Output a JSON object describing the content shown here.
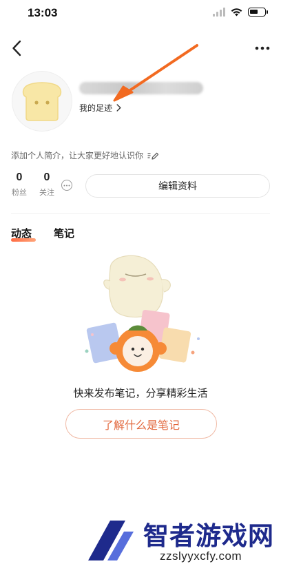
{
  "status_bar": {
    "time": "13:03",
    "battery_level": 0.6
  },
  "profile": {
    "footprint_label": "我的足迹",
    "bio_placeholder": "添加个人简介，让大家更好地认识你",
    "stats": [
      {
        "value": "0",
        "label": "粉丝"
      },
      {
        "value": "0",
        "label": "关注"
      }
    ],
    "edit_button": "编辑资料"
  },
  "tabs": [
    {
      "label": "动态",
      "active": true
    },
    {
      "label": "笔记",
      "active": false
    }
  ],
  "empty_state": {
    "message": "快来发布笔记，分享精彩生活",
    "action_button": "了解什么是笔记"
  },
  "watermark": {
    "name": "智者游戏网",
    "url": "zzslyyxcfy.com"
  },
  "colors": {
    "accent": "#ff5a2e",
    "annotation_arrow": "#f26a21",
    "watermark_blue": "#1e2a8c"
  }
}
